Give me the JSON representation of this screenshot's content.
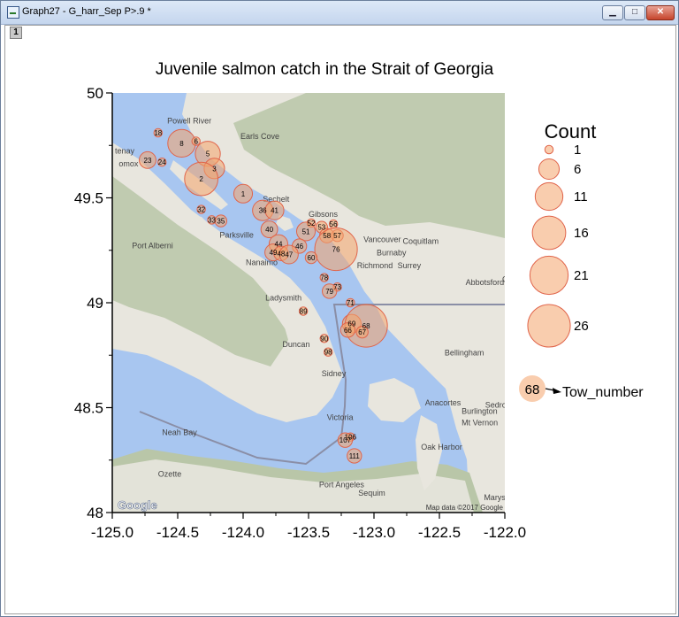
{
  "window": {
    "title": "Graph27 - G_harr_Sep P>.9 *",
    "minimize_glyph": "▁",
    "maximize_glyph": "□",
    "close_glyph": "✕",
    "layer_tab_label": "1"
  },
  "colors": {
    "bubble_fill": "#f4a46b",
    "bubble_stroke": "#e0644a",
    "water": "#a8c6f0",
    "land": "#e8e6de",
    "mountain": "#b9c6a8",
    "bubble_fill_opacity": 0.55
  },
  "map_labels": [
    {
      "text": "Powell River",
      "lon": -124.58,
      "lat": 49.855
    },
    {
      "text": "Earls Cove",
      "lon": -124.02,
      "lat": 49.78
    },
    {
      "text": "tenay",
      "lon": -124.98,
      "lat": 49.71
    },
    {
      "text": "omox",
      "lon": -124.95,
      "lat": 49.65
    },
    {
      "text": "Sechelt",
      "lon": -123.85,
      "lat": 49.48
    },
    {
      "text": "Gibsons",
      "lon": -123.5,
      "lat": 49.41
    },
    {
      "text": "Parksville",
      "lon": -124.18,
      "lat": 49.31
    },
    {
      "text": "Port Alberni",
      "lon": -124.85,
      "lat": 49.26
    },
    {
      "text": "Nanaimo",
      "lon": -123.98,
      "lat": 49.18
    },
    {
      "text": "Vancouver",
      "lon": -123.08,
      "lat": 49.29
    },
    {
      "text": "Coquitlam",
      "lon": -122.78,
      "lat": 49.28
    },
    {
      "text": "Burnaby",
      "lon": -122.98,
      "lat": 49.225
    },
    {
      "text": "Richmond",
      "lon": -123.13,
      "lat": 49.165
    },
    {
      "text": "Surrey",
      "lon": -122.82,
      "lat": 49.165
    },
    {
      "text": "Abbotsford",
      "lon": -122.3,
      "lat": 49.085
    },
    {
      "text": "Ladysmith",
      "lon": -123.83,
      "lat": 49.01
    },
    {
      "text": "Duncan",
      "lon": -123.7,
      "lat": 48.79
    },
    {
      "text": "Sidney",
      "lon": -123.4,
      "lat": 48.65
    },
    {
      "text": "Bellingham",
      "lon": -122.46,
      "lat": 48.75
    },
    {
      "text": "Victoria",
      "lon": -123.36,
      "lat": 48.44
    },
    {
      "text": "Anacortes",
      "lon": -122.61,
      "lat": 48.51
    },
    {
      "text": "Burlington",
      "lon": -122.33,
      "lat": 48.47
    },
    {
      "text": "Sedro-W",
      "lon": -122.15,
      "lat": 48.5
    },
    {
      "text": "Mt Vernon",
      "lon": -122.33,
      "lat": 48.415
    },
    {
      "text": "Neah Bay",
      "lon": -124.62,
      "lat": 48.37
    },
    {
      "text": "Oak Harbor",
      "lon": -122.64,
      "lat": 48.3
    },
    {
      "text": "Ozette",
      "lon": -124.65,
      "lat": 48.17
    },
    {
      "text": "Port Angeles",
      "lon": -123.42,
      "lat": 48.12
    },
    {
      "text": "Sequim",
      "lon": -123.12,
      "lat": 48.08
    },
    {
      "text": "Marysville",
      "lon": -122.16,
      "lat": 48.06
    },
    {
      "text": "Chi",
      "lon": -122.02,
      "lat": 49.1
    }
  ],
  "map_attribution": {
    "google": "Google",
    "credit": "Map data ©2017 Google"
  },
  "chart_data": {
    "type": "scatter",
    "subtype": "bubble-on-map",
    "title": "Juvenile salmon catch in the Strait of Georgia",
    "xlabel": "",
    "ylabel": "",
    "xlim": [
      -125.0,
      -122.0
    ],
    "ylim": [
      48.0,
      50.0
    ],
    "xticks": [
      -125.0,
      -124.5,
      -124.0,
      -123.5,
      -123.0,
      -122.5,
      -122.0
    ],
    "xtick_labels": [
      "-125.0",
      "-124.5",
      "-124.0",
      "-123.5",
      "-123.0",
      "-122.5",
      "-122.0"
    ],
    "yticks": [
      48,
      48.5,
      49,
      49.5,
      50
    ],
    "ytick_labels": [
      "48",
      "48.5",
      "49",
      "49.5",
      "50"
    ],
    "grid": false,
    "size_legend": {
      "title": "Count",
      "values": [
        1,
        6,
        11,
        16,
        21,
        26
      ]
    },
    "label_legend": {
      "example": "68",
      "text": "Tow_number"
    },
    "points": [
      {
        "tow": 18,
        "lon": -124.65,
        "lat": 49.81,
        "count": 1
      },
      {
        "tow": 8,
        "lon": -124.47,
        "lat": 49.76,
        "count": 11
      },
      {
        "tow": 6,
        "lon": -124.36,
        "lat": 49.77,
        "count": 1
      },
      {
        "tow": 5,
        "lon": -124.27,
        "lat": 49.71,
        "count": 9
      },
      {
        "tow": 23,
        "lon": -124.73,
        "lat": 49.68,
        "count": 4
      },
      {
        "tow": 24,
        "lon": -124.62,
        "lat": 49.67,
        "count": 1
      },
      {
        "tow": 3,
        "lon": -124.22,
        "lat": 49.64,
        "count": 6
      },
      {
        "tow": 2,
        "lon": -124.32,
        "lat": 49.59,
        "count": 16
      },
      {
        "tow": 1,
        "lon": -124.0,
        "lat": 49.52,
        "count": 5
      },
      {
        "tow": 32,
        "lon": -124.32,
        "lat": 49.445,
        "count": 1
      },
      {
        "tow": 36,
        "lon": -123.85,
        "lat": 49.44,
        "count": 6
      },
      {
        "tow": 41,
        "lon": -123.76,
        "lat": 49.44,
        "count": 5
      },
      {
        "tow": 33,
        "lon": -124.24,
        "lat": 49.395,
        "count": 1
      },
      {
        "tow": 35,
        "lon": -124.17,
        "lat": 49.39,
        "count": 2
      },
      {
        "tow": 52,
        "lon": -123.48,
        "lat": 49.38,
        "count": 1
      },
      {
        "tow": 56,
        "lon": -123.31,
        "lat": 49.375,
        "count": 1
      },
      {
        "tow": 53,
        "lon": -123.4,
        "lat": 49.36,
        "count": 2
      },
      {
        "tow": 40,
        "lon": -123.8,
        "lat": 49.35,
        "count": 4
      },
      {
        "tow": 51,
        "lon": -123.52,
        "lat": 49.34,
        "count": 5
      },
      {
        "tow": 58,
        "lon": -123.36,
        "lat": 49.32,
        "count": 3
      },
      {
        "tow": 57,
        "lon": -123.28,
        "lat": 49.32,
        "count": 2
      },
      {
        "tow": 44,
        "lon": -123.73,
        "lat": 49.28,
        "count": 5
      },
      {
        "tow": 46,
        "lon": -123.57,
        "lat": 49.27,
        "count": 3
      },
      {
        "tow": 76,
        "lon": -123.29,
        "lat": 49.255,
        "count": 26
      },
      {
        "tow": 49,
        "lon": -123.77,
        "lat": 49.24,
        "count": 4
      },
      {
        "tow": 48,
        "lon": -123.71,
        "lat": 49.235,
        "count": 3
      },
      {
        "tow": 47,
        "lon": -123.65,
        "lat": 49.23,
        "count": 5
      },
      {
        "tow": 60,
        "lon": -123.48,
        "lat": 49.215,
        "count": 2
      },
      {
        "tow": 78,
        "lon": -123.38,
        "lat": 49.12,
        "count": 1
      },
      {
        "tow": 73,
        "lon": -123.28,
        "lat": 49.075,
        "count": 1
      },
      {
        "tow": 79,
        "lon": -123.34,
        "lat": 49.055,
        "count": 3
      },
      {
        "tow": 71,
        "lon": -123.18,
        "lat": 49.0,
        "count": 1
      },
      {
        "tow": 89,
        "lon": -123.54,
        "lat": 48.96,
        "count": 1
      },
      {
        "tow": 69,
        "lon": -123.17,
        "lat": 48.9,
        "count": 5
      },
      {
        "tow": 68,
        "lon": -123.06,
        "lat": 48.89,
        "count": 26
      },
      {
        "tow": 66,
        "lon": -123.2,
        "lat": 48.87,
        "count": 3
      },
      {
        "tow": 67,
        "lon": -123.09,
        "lat": 48.86,
        "count": 2
      },
      {
        "tow": 90,
        "lon": -123.38,
        "lat": 48.83,
        "count": 1
      },
      {
        "tow": 98,
        "lon": -123.35,
        "lat": 48.765,
        "count": 1
      },
      {
        "tow": 106,
        "lon": -123.18,
        "lat": 48.36,
        "count": 1
      },
      {
        "tow": 107,
        "lon": -123.22,
        "lat": 48.345,
        "count": 3
      },
      {
        "tow": 111,
        "lon": -123.15,
        "lat": 48.27,
        "count": 3
      }
    ]
  }
}
